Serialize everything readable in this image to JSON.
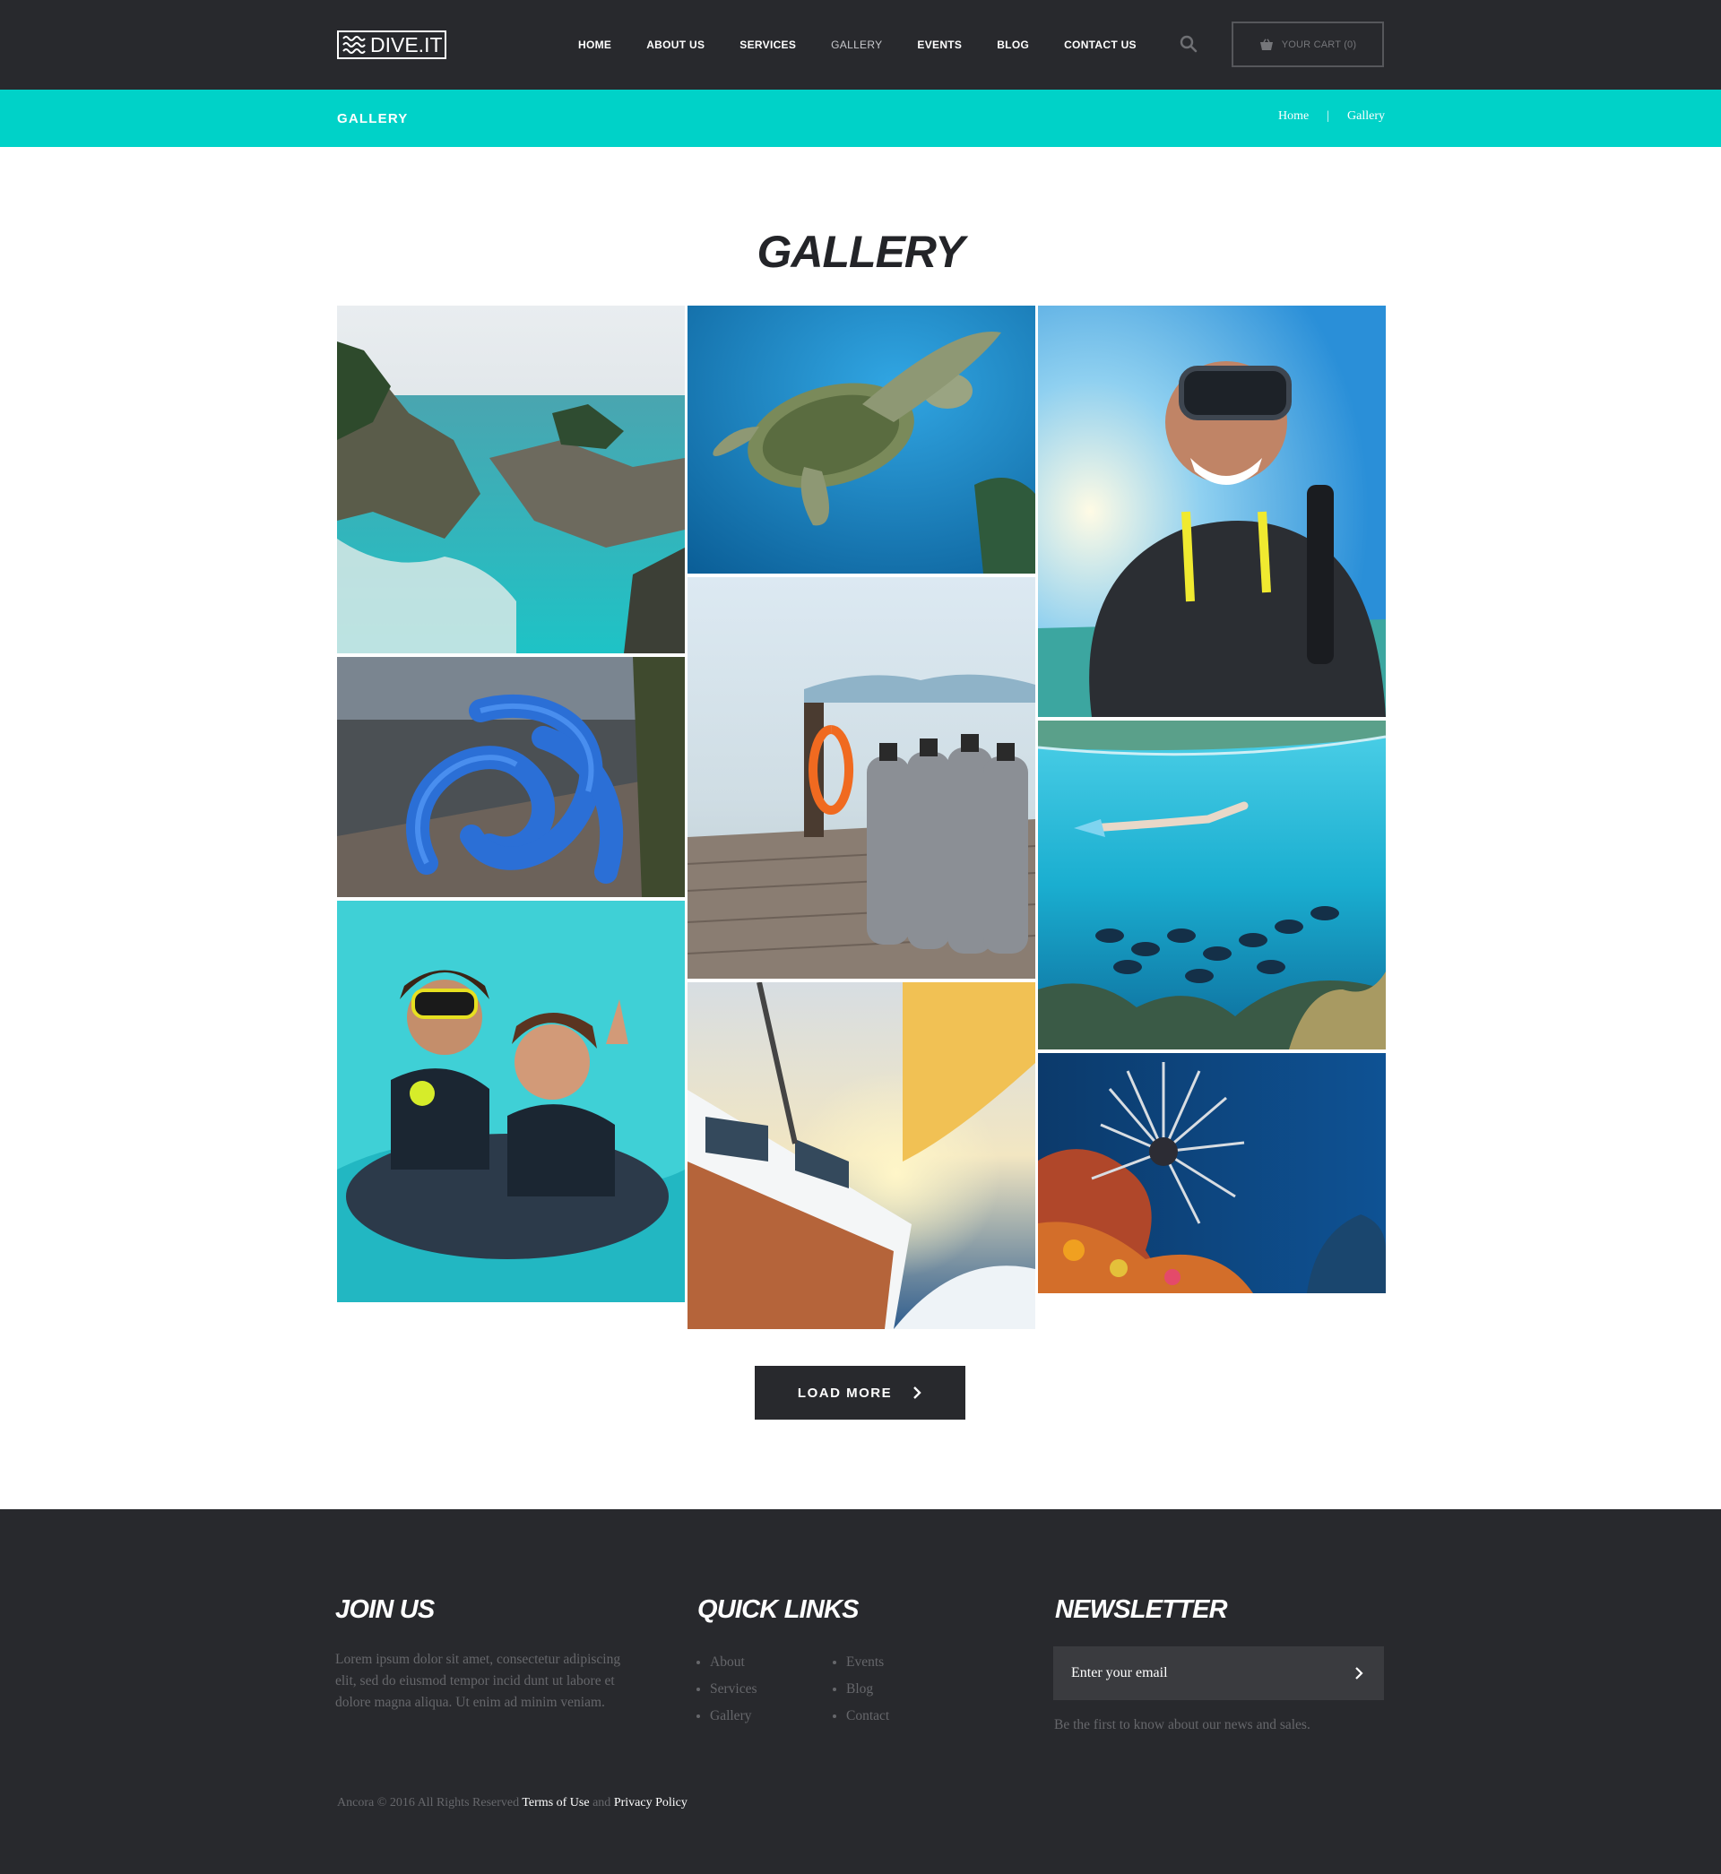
{
  "header": {
    "logo_text": "DIVE.IT",
    "nav": [
      {
        "label": "HOME",
        "active": false
      },
      {
        "label": "ABOUT US",
        "active": false
      },
      {
        "label": "SERVICES",
        "active": false
      },
      {
        "label": "GALLERY",
        "active": true
      },
      {
        "label": "EVENTS",
        "active": false
      },
      {
        "label": "BLOG",
        "active": false
      },
      {
        "label": "CONTACT US",
        "active": false
      }
    ],
    "cart_label": "YOUR CART (0)"
  },
  "titlebar": {
    "title": "GALLERY",
    "breadcrumb": {
      "home": "Home",
      "separator": "|",
      "current": "Gallery"
    }
  },
  "main": {
    "title": "GALLERY",
    "gallery": [
      {
        "name": "coastal-cliffs"
      },
      {
        "name": "blue-rope-knot"
      },
      {
        "name": "two-divers-smiling"
      },
      {
        "name": "sea-turtle"
      },
      {
        "name": "scuba-tanks-dock"
      },
      {
        "name": "sailboat-sunset"
      },
      {
        "name": "diver-selfie"
      },
      {
        "name": "freediver-reef-fish"
      },
      {
        "name": "sea-urchin-coral"
      }
    ],
    "load_more_label": "LOAD MORE"
  },
  "footer": {
    "join": {
      "heading": "JOIN US",
      "text": "Lorem ipsum dolor sit amet, consectetur adipiscing elit, sed do eiusmod tempor incid dunt ut labore et dolore magna aliqua. Ut enim ad minim veniam."
    },
    "quick_links": {
      "heading": "QUICK LINKS",
      "col1": [
        "About",
        "Services",
        "Gallery"
      ],
      "col2": [
        "Events",
        "Blog",
        "Contact"
      ]
    },
    "newsletter": {
      "heading": "NEWSLETTER",
      "placeholder": "Enter your email",
      "note": "Be the first to know about our news and sales."
    },
    "copyright": {
      "prefix": "Ancora © 2016 All Rights Reserved",
      "terms": "Terms of Use",
      "and": "and",
      "privacy": "Privacy Policy"
    }
  },
  "colors": {
    "header_bg": "#28292d",
    "accent": "#00d2c8",
    "footer_bg": "#28292d",
    "input_bg": "#3a3b3f"
  }
}
